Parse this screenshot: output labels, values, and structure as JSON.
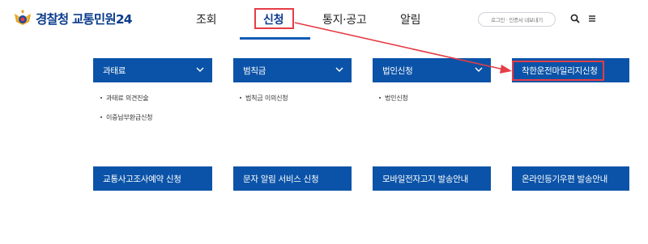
{
  "header": {
    "logo_text": "경찰청 교통민원24",
    "nav": [
      "조회",
      "신청",
      "통지·공고",
      "알림"
    ],
    "login_label": "로그인 · 인증서 내보내기"
  },
  "menu": {
    "cards_top": [
      {
        "label": "과태료",
        "items": [
          "과태료 의견진술",
          "이중납부환급신청"
        ]
      },
      {
        "label": "범칙금",
        "items": [
          "범칙금 이의신청"
        ]
      },
      {
        "label": "법인신청",
        "items": [
          "법인신청"
        ]
      },
      {
        "label": "착한운전마일리지신청"
      }
    ],
    "cards_bottom": [
      {
        "label": "교통사고조사예약 신청"
      },
      {
        "label": "문자 알림 서비스 신청"
      },
      {
        "label": "모바일전자고지 발송안내"
      },
      {
        "label": "온라인등기우편 발송안내"
      }
    ]
  },
  "colors": {
    "primary": "#0b53a8",
    "brand_text": "#0b3c8c",
    "highlight": "#e53d45"
  }
}
